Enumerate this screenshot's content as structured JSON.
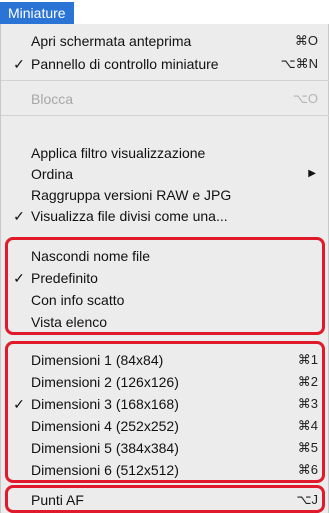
{
  "menubar": {
    "title": "Miniature"
  },
  "menu": {
    "items": [
      {
        "label": "Apri schermata anteprima",
        "shortcut": "⌘O",
        "checked": "",
        "disabled": false
      },
      {
        "label": "Pannello di controllo miniature",
        "shortcut": "⌥⌘N",
        "checked": "✓",
        "disabled": false
      },
      {
        "label": "Blocca",
        "shortcut": "⌥O",
        "checked": "",
        "disabled": true
      },
      {
        "label": "Applica filtro visualizzazione",
        "shortcut": "",
        "checked": "",
        "disabled": false
      },
      {
        "label": "Ordina",
        "shortcut": "▶",
        "checked": "",
        "disabled": false
      },
      {
        "label": "Raggruppa versioni RAW e JPG",
        "shortcut": "",
        "checked": "",
        "disabled": false
      },
      {
        "label": "Visualizza file divisi come una...",
        "shortcut": "",
        "checked": "✓",
        "disabled": false
      },
      {
        "label": "Nascondi nome file",
        "shortcut": "",
        "checked": "",
        "disabled": false
      },
      {
        "label": "Predefinito",
        "shortcut": "",
        "checked": "✓",
        "disabled": false
      },
      {
        "label": "Con info scatto",
        "shortcut": "",
        "checked": "",
        "disabled": false
      },
      {
        "label": "Vista elenco",
        "shortcut": "",
        "checked": "",
        "disabled": false
      },
      {
        "label": "Dimensioni 1 (84x84)",
        "shortcut": "⌘1",
        "checked": "",
        "disabled": false
      },
      {
        "label": "Dimensioni 2 (126x126)",
        "shortcut": "⌘2",
        "checked": "",
        "disabled": false
      },
      {
        "label": "Dimensioni 3 (168x168)",
        "shortcut": "⌘3",
        "checked": "✓",
        "disabled": false
      },
      {
        "label": "Dimensioni 4 (252x252)",
        "shortcut": "⌘4",
        "checked": "",
        "disabled": false
      },
      {
        "label": "Dimensioni 5 (384x384)",
        "shortcut": "⌘5",
        "checked": "",
        "disabled": false
      },
      {
        "label": "Dimensioni 6 (512x512)",
        "shortcut": "⌘6",
        "checked": "",
        "disabled": false
      },
      {
        "label": "Punti AF",
        "shortcut": "⌥J",
        "checked": "",
        "disabled": false
      }
    ]
  },
  "highlight_color": "#e0192b",
  "accent_color": "#2a74d6"
}
